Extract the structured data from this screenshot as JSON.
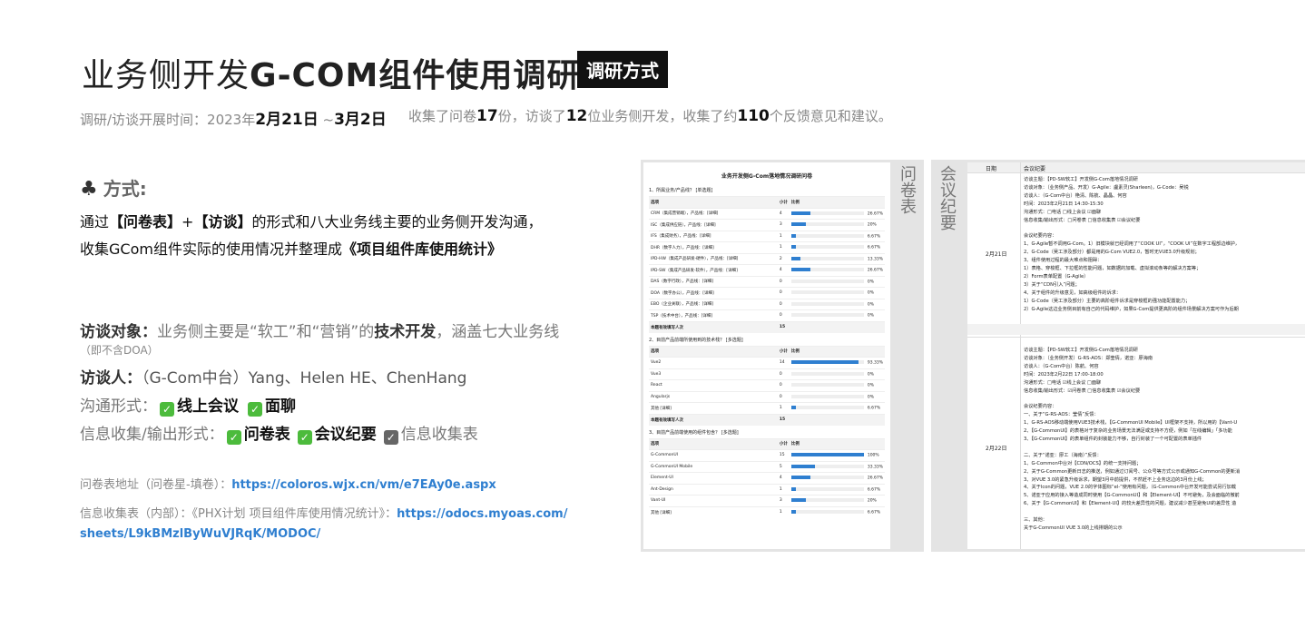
{
  "header": {
    "title_light": "业务侧开发",
    "title_bold": "G-COM组件使用调研",
    "badge": "调研方式"
  },
  "summary": {
    "time_label": "调研/访谈开展时间：2023年",
    "date_start": "2月21日",
    "date_mid": " ~",
    "date_end": "3月2日",
    "collect_a": "收集了问卷",
    "num_questionnaires": "17",
    "collect_b": "份，访谈了",
    "num_people": "12",
    "collect_c": "位业务侧开发，收集了约",
    "num_feedback": "110",
    "collect_d": "个反馈意见和建议。"
  },
  "method": {
    "icon": "club-icon",
    "heading": "方式:",
    "line1_a": "通过",
    "line1_b": "【问卷表】",
    "line1_c": "+",
    "line1_d": "【访谈】",
    "line1_e": "的形式和八大业务线主要的业务侧开发沟通，",
    "line2_a": "收集GCom组件实际的使用情况并整理成",
    "line2_b": "《项目组件库使用统计》"
  },
  "info": {
    "target_label": "访谈对象：",
    "target_text_a": "业务侧主要是“软工”和“营销”的",
    "target_text_b": "技术开发",
    "target_text_c": "，涵盖七大业务线",
    "target_note": "（即不含DOA）",
    "interviewer_label": "访谈人：",
    "interviewer_text": "（G-Com中台）Yang、Helen HE、ChenHang",
    "channel_label": "沟通形式：",
    "channel_1": "线上会议",
    "channel_2": "面聊",
    "output_label": "信息收集/输出形式：",
    "output_1": "问卷表",
    "output_2": "会议纪要",
    "output_3": "信息收集表"
  },
  "links": {
    "q_label": "问卷表地址（问卷星-填卷）：",
    "q_url": "https://coloros.wjx.cn/vm/e7EAy0e.aspx",
    "sheet_label": "信息收集表（内部）：《PHX计划 项目组件库使用情况统计》：",
    "sheet_url_1": "https://odocs.myoas.com/",
    "sheet_url_2": "sheets/L9kBMzlByWuVJRqK/MODOC/"
  },
  "questionnaire": {
    "side_label": "问卷表",
    "title": "业务开发侧G-Com落地情况调研问卷",
    "q1": {
      "title": "1、所属业务/产品线？ [单选题]",
      "headers": [
        "选项",
        "小计",
        "比例"
      ],
      "rows": [
        {
          "label": "CRM（集成营销端），产品线：[详细]",
          "count": "4",
          "pct": "26.67%",
          "frac": 0.2667
        },
        {
          "label": "ISC（集成供应链），产品线：[详细]",
          "count": "3",
          "pct": "20%",
          "frac": 0.2
        },
        {
          "label": "IFS（集成财务），产品线：[详细]",
          "count": "1",
          "pct": "6.67%",
          "frac": 0.0667
        },
        {
          "label": "DHR（数字人力），产品线：[详细]",
          "count": "1",
          "pct": "6.67%",
          "frac": 0.0667
        },
        {
          "label": "IPD-HW（集成产品研发-硬件），产品线：[详细]",
          "count": "2",
          "pct": "13.33%",
          "frac": 0.1333
        },
        {
          "label": "IPD-SW（集成产品研发-软件），产品线：[详细]",
          "count": "4",
          "pct": "26.67%",
          "frac": 0.2667
        },
        {
          "label": "DAS（数字行政），产品线：[详细]",
          "count": "0",
          "pct": "0%",
          "frac": 0
        },
        {
          "label": "DOA（数字办公），产品线：[详细]",
          "count": "0",
          "pct": "0%",
          "frac": 0
        },
        {
          "label": "EBO（企业关联），产品线：[详细]",
          "count": "0",
          "pct": "0%",
          "frac": 0
        },
        {
          "label": "TSP（技术中台），产品线：[详细]",
          "count": "0",
          "pct": "0%",
          "frac": 0
        }
      ],
      "total_label": "本题有效填写人次",
      "total": "15"
    },
    "q2": {
      "title": "2、目前产品前端所使用到的技术栈？ [多选题]",
      "headers": [
        "选项",
        "小计",
        "比例"
      ],
      "rows": [
        {
          "label": "Vue2",
          "count": "14",
          "pct": "93.33%",
          "frac": 0.9333
        },
        {
          "label": "Vue3",
          "count": "0",
          "pct": "0%",
          "frac": 0
        },
        {
          "label": "React",
          "count": "0",
          "pct": "0%",
          "frac": 0
        },
        {
          "label": "Angularjs",
          "count": "0",
          "pct": "0%",
          "frac": 0
        },
        {
          "label": "其他 [详细]",
          "count": "1",
          "pct": "6.67%",
          "frac": 0.0667
        }
      ],
      "total_label": "本题有效填写人次",
      "total": "15"
    },
    "q3": {
      "title": "3、目前产品前端使用的组件包含？ [多选题]",
      "headers": [
        "选项",
        "小计",
        "比例"
      ],
      "rows": [
        {
          "label": "G-CommonUI",
          "count": "15",
          "pct": "100%",
          "frac": 1.0
        },
        {
          "label": "G-CommonUI Mobile",
          "count": "5",
          "pct": "33.33%",
          "frac": 0.3333
        },
        {
          "label": "Element-UI",
          "count": "4",
          "pct": "26.67%",
          "frac": 0.2667
        },
        {
          "label": "Ant-Design",
          "count": "1",
          "pct": "6.67%",
          "frac": 0.0667
        },
        {
          "label": "Vant-UI",
          "count": "3",
          "pct": "20%",
          "frac": 0.2
        },
        {
          "label": "其他 [详细]",
          "count": "1",
          "pct": "6.67%",
          "frac": 0.0667
        }
      ]
    }
  },
  "meeting": {
    "side_label": "会议纪要",
    "col_date": "日期",
    "col_content": "会议纪要",
    "entry1": {
      "date": "2月21日",
      "lines": [
        "访谈主题：【PD-SW软工】开发侧G-Com落地情况调研",
        "访谈对象：（业务侧产品、开发）G-Agile：盧素灵(Sharleen)，G-Code：吴锐",
        "访谈人：（G-Com中台）艳清、陈航、晶晶、何容",
        "时间：2023年2月21日 14:30-15:30",
        "沟通形式：□电话 □线上会议 ☑面聊",
        "信息收集/输出形式：□问卷表 □信息收集表 ☑会议纪要",
        "",
        "会议纪要内容：",
        "1、G-Agile暂不调用G-Com。1）旧模块就已经调用了“COOK UI”，“COOK UI”在数字工程部边维护，",
        "2、G-Code（吴工涉及部分）都是用的G-Com VUE2.0，暂时无VUE3.0升级规划；",
        "3、组件使用过程的最大难点和阻碍：",
        "1）表格、穿梭框、下拉框的性能问题，如数据的加载、虚拟滚动条等的解决方案等；",
        "2）Form表单配置（G-Agile）",
        "3）关于“CDN引入”问题；",
        "4、关于组件的升级意见，如高级组件的诉求：",
        "1）G-Code（吴工涉及部分）主要的高阶组件诉求是穿梭框的强功能配置能力；",
        "2）G-Agile这边业务侧目前有自己的代码维护，如果G-Com提供更高阶的组件场景解决方案可作为后期"
      ]
    },
    "entry2": {
      "date": "2月22日",
      "lines": [
        "访谈主题：【PD-SW软工】开发侧G-Com落地情况调研",
        "访谈对象：（业务侧开发）G-RS-AOS：郑莹倩，诺亚：廖海南",
        "访谈人：（G-Com中台）陈航、何容",
        "时间：2023年2月22日 17:00-18:00",
        "沟通形式：□电话 ☑线上会议 □面聊",
        "信息收集/输出形式：☑问卷表 □信息收集表 ☑会议纪要",
        "",
        "会议纪要内容：",
        "一、关于“G-RS-AOS：莹倩”反馈：",
        "1、G-RS-AOS移动端使用VUE3技术栈，【G-CommonUI Mobile】UI框架不支持，所以用的【Vant-U",
        "2、【G-CommonUI】的表格对于复杂的业务场景无法满足或支持不方便，例如「在线编辑」「多功能",
        "3、【G-CommonUI】的表单组件的封装能力不够，自行封装了一个可配置的表单插件",
        "",
        "二、关于“诺亚：廖工（海南）”反馈：",
        "1、G-Common中台对【CDN/OCS】的统一支持问题；",
        "2、关于G-Common更新日志的推送，例如通过订阅号、公众号等方式公示或通知G-Common的更新消",
        "3、对VUE 3.0的紧急升级诉求，期望3月中前提供，不然赶不上业务这边的3月份上线；",
        "4、关于Icon的问题，VUE 2.0的字体图标“el-”使用有问题，（G-Common中台开发可能尝试另行加载",
        "5、诺亚于应用的接入等造成同时使用【G-CommonUI】和【Element-UI】不可避免，及会面临的微前",
        "6、关于【G-CommonUI】和【Element-UI】的较大差异性的问题，建议减少甚至避免UI的差异性 造",
        "",
        "三、其他：",
        "关于G-CommonUI VUE 3.0的上线排期的公示"
      ]
    }
  }
}
